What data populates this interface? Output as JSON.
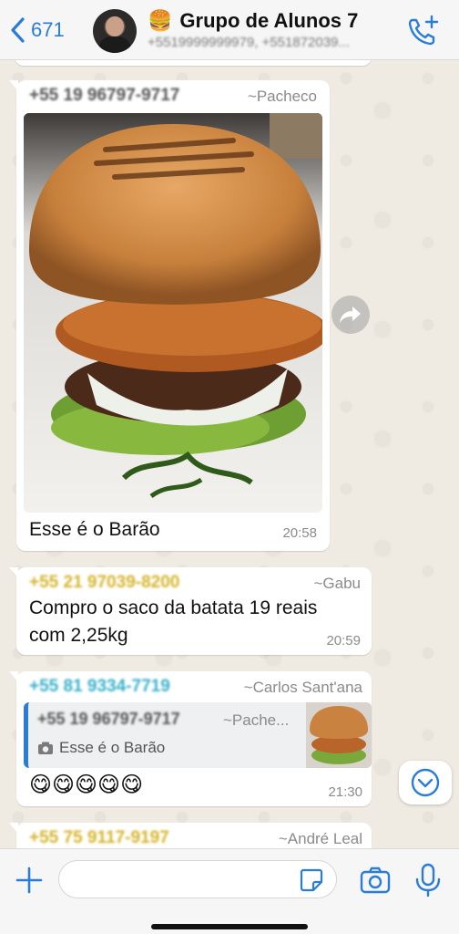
{
  "header": {
    "back_count": "671",
    "group_emoji": "🍔",
    "group_name": "Grupo de Alunos 7",
    "members_preview": "+5519999999979, +551872039..."
  },
  "messages": [
    {
      "sender_phone": "+55 19 96797-9717",
      "sender_alias": "~Pacheco",
      "text": "Esse é o Barão",
      "time": "20:58",
      "sender_color": "#545454"
    },
    {
      "sender_phone": "+55 21 97039-8200",
      "sender_alias": "~Gabu",
      "text_line1": "Compro o saco da batata 19 reais",
      "text_line2": "com 2,25kg",
      "time": "20:59",
      "sender_color": "#d4b429"
    },
    {
      "sender_phone": "+55 81 9334-7719",
      "sender_alias": "~Carlos Sant'ana",
      "quote_phone": "+55 19 96797-9717",
      "quote_alias": "~Pache...",
      "quote_text": "Esse é o Barão",
      "text": "😋😋😋😋😋",
      "time": "21:30",
      "sender_color": "#35b0c9"
    },
    {
      "sender_phone": "+55 75 9117-9197",
      "sender_alias": "~André Leal",
      "sender_color": "#d4b429"
    }
  ],
  "input": {
    "placeholder": ""
  },
  "colors": {
    "accent_blue": "#2a7dd6",
    "chat_background": "#efeae2"
  },
  "icons": [
    "chevron-left-icon",
    "call-add-icon",
    "camera-icon",
    "forward-icon",
    "chevron-down-icon",
    "plus-icon",
    "sticker-icon",
    "mic-icon"
  ]
}
